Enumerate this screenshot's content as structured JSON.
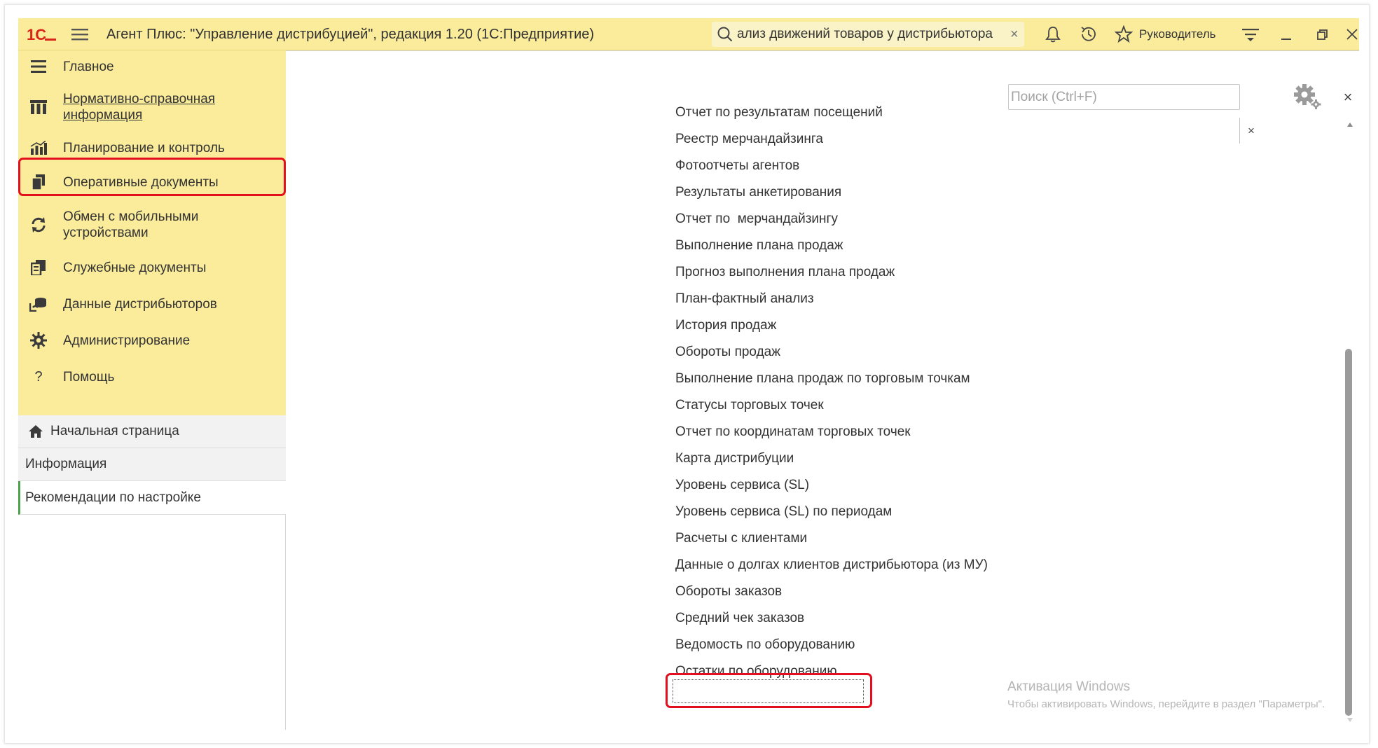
{
  "window": {
    "title": "Агент Плюс: \"Управление дистрибуцией\", редакция 1.20  (1С:Предприятие)",
    "search_text": "ализ движений товаров у дистрибьютора",
    "user": "Руководитель",
    "logo_text": "1С"
  },
  "nav": {
    "items": [
      {
        "label": "Главное",
        "icon": "menu-list-icon"
      },
      {
        "label": "Нормативно-справочная информация",
        "icon": "catalog-icon"
      },
      {
        "label": "Планирование и контроль",
        "icon": "bar-chart-icon",
        "highlighted": true
      },
      {
        "label": "Оперативные документы",
        "icon": "documents-icon"
      },
      {
        "label": "Обмен с мобильными устройствами",
        "icon": "sync-icon"
      },
      {
        "label": "Служебные документы",
        "icon": "service-documents-icon"
      },
      {
        "label": "Данные дистрибьюторов",
        "icon": "distributor-data-icon"
      },
      {
        "label": "Администрирование",
        "icon": "gear-icon"
      },
      {
        "label": "Помощь",
        "icon": "question-icon"
      }
    ],
    "highlight_color": "#e2101f",
    "background": "#fbec9c"
  },
  "sections": [
    {
      "label": "Начальная страница",
      "icon": "home-icon"
    },
    {
      "label": "Информация"
    },
    {
      "label": "Рекомендации по настройке",
      "active": true
    }
  ],
  "panel": {
    "search_placeholder": "Поиск (Ctrl+F)",
    "clear_label": "×",
    "close_label": "×"
  },
  "reports": [
    "Отчет по результатам посещений",
    "Реестр мерчандайзинга",
    "Фотоотчеты агентов",
    "Результаты анкетирования",
    "Отчет по  мерчандайзингу",
    "Выполнение плана продаж",
    "Прогноз выполнения плана продаж",
    "План-фактный анализ",
    "История продаж",
    "Обороты продаж",
    "Выполнение плана продаж по торговым точкам",
    "Статусы торговых точек",
    "Отчет по координатам торговых точек",
    "Карта дистрибуции",
    "Уровень сервиса (SL)",
    "Уровень сервиса (SL) по периодам",
    "Расчеты с клиентами",
    "Данные о долгах клиентов дистрибьютора (из МУ)",
    "Обороты заказов",
    "Средний чек заказов",
    "Ведомость по оборудованию",
    "Остатки по оборудованию"
  ],
  "selected_report": "Ведомость по оборудованию",
  "watermark": {
    "title": "Активация Windows",
    "subtitle": "Чтобы активировать Windows, перейдите в раздел \"Параметры\"."
  }
}
